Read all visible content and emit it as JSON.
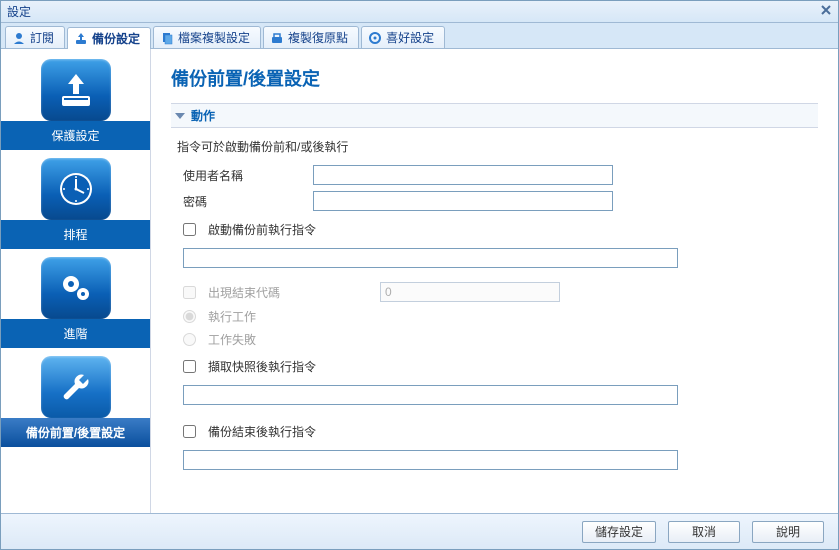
{
  "window": {
    "title": "設定"
  },
  "tabs": [
    {
      "label": "訂閱",
      "active": false
    },
    {
      "label": "備份設定",
      "active": true
    },
    {
      "label": "檔案複製設定",
      "active": false
    },
    {
      "label": "複製復原點",
      "active": false
    },
    {
      "label": "喜好設定",
      "active": false
    }
  ],
  "sidebar": {
    "items": [
      {
        "label": "保護設定",
        "icon": "drive-download-icon"
      },
      {
        "label": "排程",
        "icon": "clock-icon"
      },
      {
        "label": "進階",
        "icon": "gears-icon"
      },
      {
        "label": "備份前置/後置設定",
        "icon": "wrench-icon",
        "active": true
      }
    ]
  },
  "page": {
    "title": "備份前置/後置設定",
    "section": "動作",
    "description": "指令可於啟動備份前和/或後執行",
    "username_label": "使用者名稱",
    "username_value": "",
    "password_label": "密碼",
    "password_value": "",
    "pre_cmd_label": "啟動備份前執行指令",
    "pre_cmd_value": "",
    "exit_code_label": "出現結束代碼",
    "exit_code_value": "0",
    "run_job_label": "執行工作",
    "fail_job_label": "工作失敗",
    "post_snapshot_label": "擷取快照後執行指令",
    "post_snapshot_value": "",
    "post_backup_label": "備份結束後執行指令",
    "post_backup_value": ""
  },
  "footer": {
    "save": "儲存設定",
    "cancel": "取消",
    "help": "說明"
  }
}
